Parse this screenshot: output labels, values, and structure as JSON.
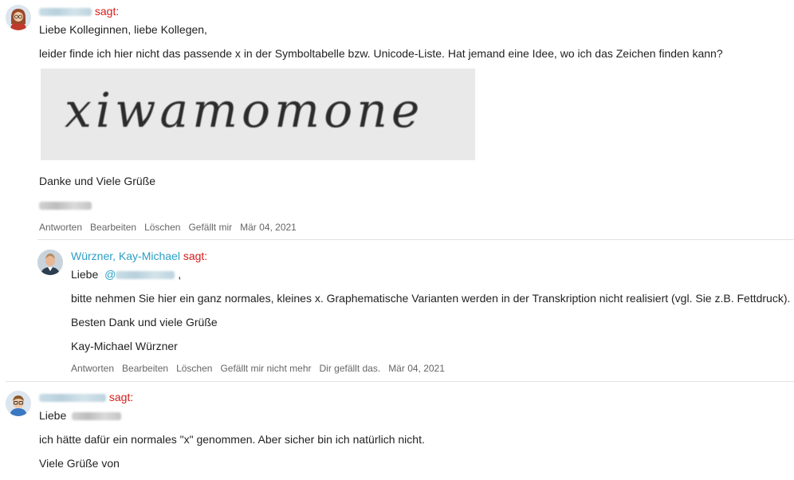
{
  "comments": [
    {
      "author_redacted": true,
      "says": "sagt:",
      "lines": [
        "Liebe Kolleginnen, liebe Kollegen,",
        "leider finde ich hier nicht das passende x in der Symboltabelle bzw. Unicode-Liste. Hat jemand eine Idee, wo ich das Zeichen finden kann?",
        "Danke und Viele Grüße"
      ],
      "image_text": "xiwamomone",
      "actions": [
        "Antworten",
        "Bearbeiten",
        "Löschen",
        "Gefällt mir"
      ],
      "date": "Mär 04, 2021"
    },
    {
      "author": "Würzner, Kay-Michael",
      "says": "sagt:",
      "greeting": "Liebe",
      "mention_prefix": "@",
      "greeting_suffix": ",",
      "lines": [
        "bitte nehmen Sie hier ein ganz normales, kleines x. Graphematische Varianten werden in der Transkription nicht realisiert (vgl. Sie z.B. Fettdruck).",
        "Besten Dank und viele Grüße",
        "Kay-Michael Würzner"
      ],
      "actions": [
        "Antworten",
        "Bearbeiten",
        "Löschen",
        "Gefällt mir nicht mehr",
        "Dir gefällt das."
      ],
      "date": "Mär 04, 2021"
    },
    {
      "author_redacted": true,
      "says": "sagt:",
      "greeting": "Liebe",
      "lines": [
        "ich hätte dafür ein normales \"x\" genommen. Aber sicher bin ich natürlich nicht.",
        "Viele Grüße von"
      ]
    }
  ],
  "colors": {
    "author": "#2a9fc4",
    "says": "#d81b1b",
    "text": "#222222",
    "meta": "#666666"
  }
}
